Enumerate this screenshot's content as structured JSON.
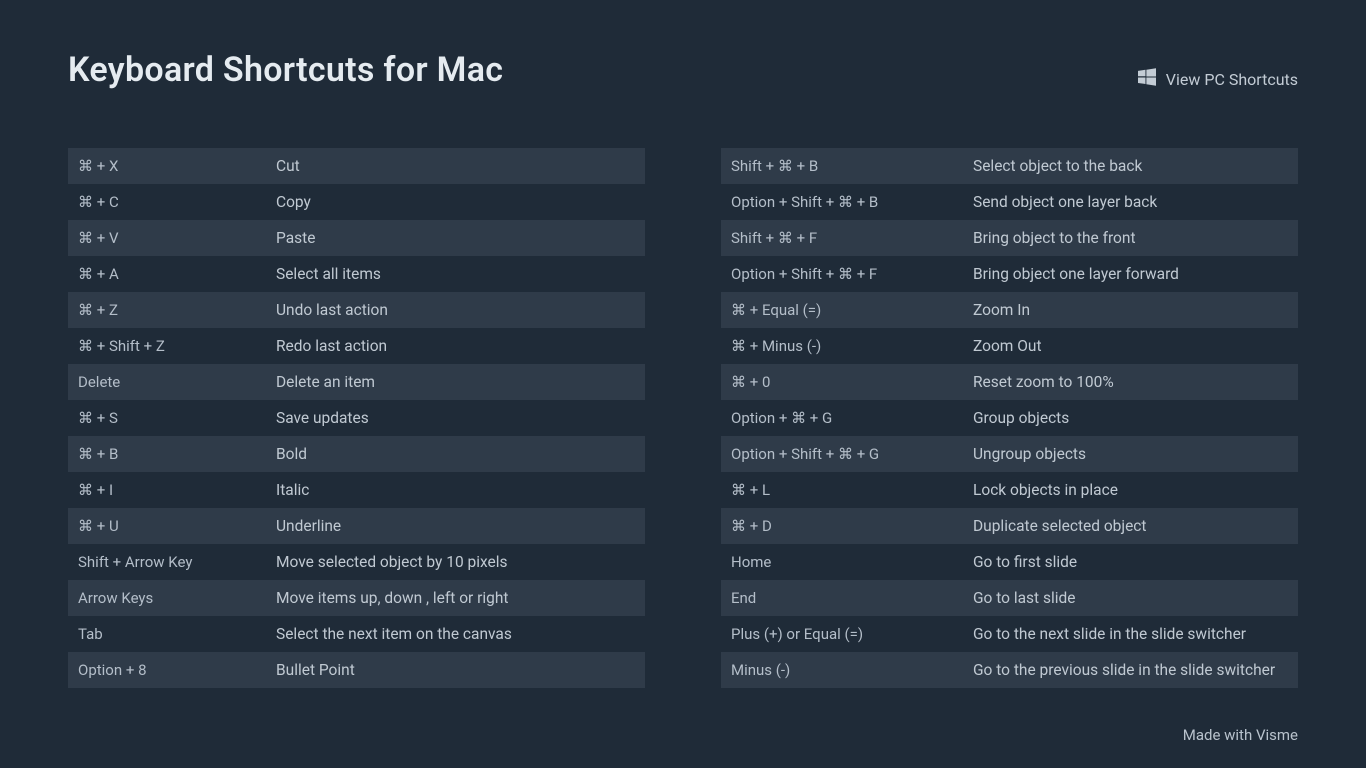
{
  "title": "Keyboard Shortcuts for Mac",
  "switch_label": "View PC Shortcuts",
  "footer": "Made with Visme",
  "left": [
    {
      "k": "⌘ + X",
      "d": "Cut",
      "s": true
    },
    {
      "k": "⌘ + C",
      "d": "Copy",
      "s": false
    },
    {
      "k": "⌘ + V",
      "d": "Paste",
      "s": true
    },
    {
      "k": "⌘ + A",
      "d": "Select all items",
      "s": false
    },
    {
      "k": "⌘ + Z",
      "d": "Undo last action",
      "s": true
    },
    {
      "k": "⌘ + Shift + Z",
      "d": "Redo last action",
      "s": false
    },
    {
      "k": "Delete",
      "d": "Delete an item",
      "s": true
    },
    {
      "k": "⌘ + S",
      "d": "Save updates",
      "s": false
    },
    {
      "k": "⌘ + B",
      "d": "Bold",
      "s": true
    },
    {
      "k": "⌘ + I",
      "d": "Italic",
      "s": false
    },
    {
      "k": "⌘ + U",
      "d": "Underline",
      "s": true
    },
    {
      "k": "Shift + Arrow Key",
      "d": "Move selected object by 10 pixels",
      "s": false
    },
    {
      "k": "Arrow Keys",
      "d": "Move items up, down , left or right",
      "s": true
    },
    {
      "k": "Tab",
      "d": "Select the next item on the canvas",
      "s": false
    },
    {
      "k": "Option + 8",
      "d": "Bullet Point",
      "s": true
    }
  ],
  "right": [
    {
      "k": "Shift + ⌘ + B",
      "d": "Select object to the back",
      "s": true
    },
    {
      "k": "Option + Shift + ⌘ + B",
      "d": "Send object one layer back",
      "s": false
    },
    {
      "k": "Shift + ⌘ + F",
      "d": "Bring object to the front",
      "s": true
    },
    {
      "k": "Option + Shift + ⌘ + F",
      "d": "Bring object one layer forward",
      "s": false
    },
    {
      "k": "⌘ + Equal (=)",
      "d": "Zoom In",
      "s": true
    },
    {
      "k": "⌘ + Minus (-)",
      "d": "Zoom Out",
      "s": false
    },
    {
      "k": "⌘ + 0",
      "d": "Reset zoom to 100%",
      "s": true
    },
    {
      "k": "Option + ⌘ + G",
      "d": "Group objects",
      "s": false
    },
    {
      "k": "Option + Shift + ⌘ + G",
      "d": "Ungroup objects",
      "s": true
    },
    {
      "k": "⌘ + L",
      "d": "Lock objects in place",
      "s": false
    },
    {
      "k": "⌘ + D",
      "d": "Duplicate selected object",
      "s": true
    },
    {
      "k": "Home",
      "d": "Go to first slide",
      "s": false
    },
    {
      "k": "End",
      "d": "Go to last slide",
      "s": true
    },
    {
      "k": "Plus (+) or Equal (=)",
      "d": "Go to the next slide in the slide switcher",
      "s": false
    },
    {
      "k": "Minus (-)",
      "d": "Go to the previous slide in the slide switcher",
      "s": true
    }
  ]
}
